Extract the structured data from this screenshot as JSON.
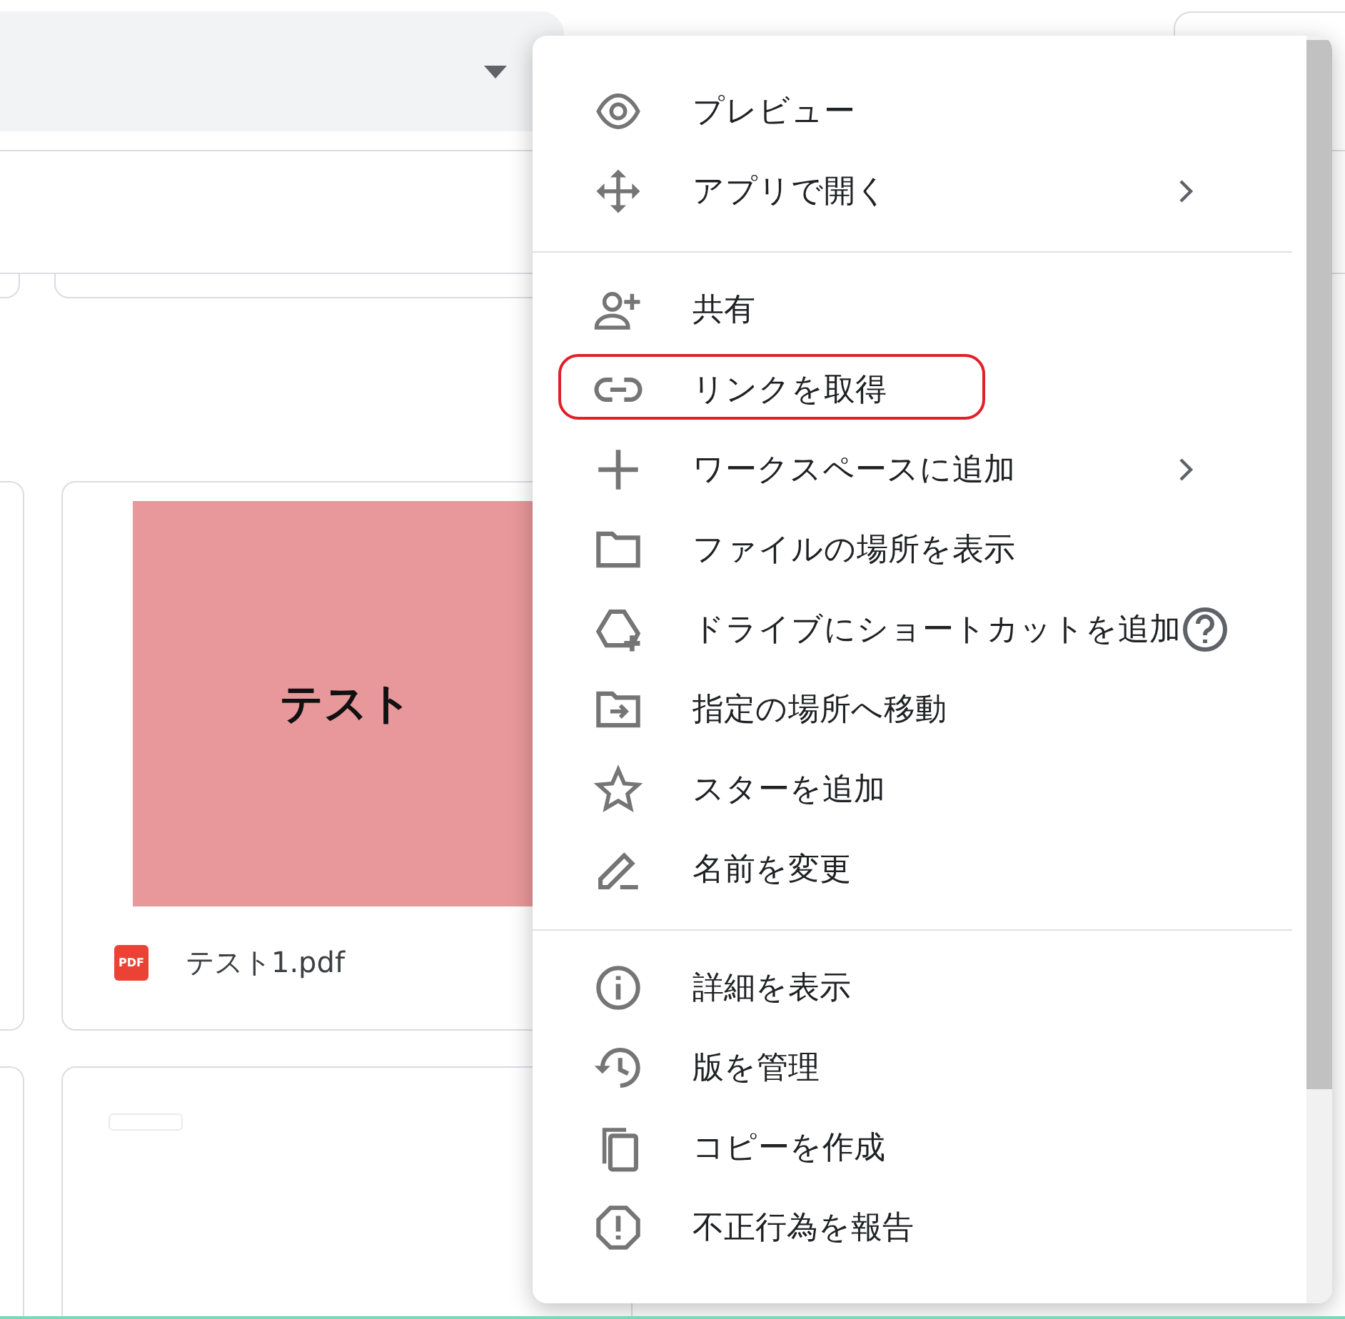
{
  "files": [
    {
      "name": "テスト1.pdf",
      "thumbnail_text": "テスト",
      "file_type": "PDF"
    }
  ],
  "context_menu": {
    "sections": [
      [
        {
          "label": "プレビュー",
          "submenu": false,
          "highlighted": false
        },
        {
          "label": "アプリで開く",
          "submenu": true,
          "highlighted": false
        }
      ],
      [
        {
          "label": "共有",
          "submenu": false,
          "highlighted": false
        },
        {
          "label": "リンクを取得",
          "submenu": false,
          "highlighted": true
        },
        {
          "label": "ワークスペースに追加",
          "submenu": true,
          "highlighted": false
        },
        {
          "label": "ファイルの場所を表示",
          "submenu": false,
          "highlighted": false
        },
        {
          "label": "ドライブにショートカットを追加",
          "submenu": false,
          "highlighted": false
        },
        {
          "label": "指定の場所へ移動",
          "submenu": false,
          "highlighted": false
        },
        {
          "label": "スターを追加",
          "submenu": false,
          "highlighted": false
        },
        {
          "label": "名前を変更",
          "submenu": false,
          "highlighted": false
        }
      ],
      [
        {
          "label": "詳細を表示",
          "submenu": false,
          "highlighted": false
        },
        {
          "label": "版を管理",
          "submenu": false,
          "highlighted": false
        },
        {
          "label": "コピーを作成",
          "submenu": false,
          "highlighted": false
        },
        {
          "label": "不正行為を報告",
          "submenu": false,
          "highlighted": false
        }
      ]
    ]
  }
}
